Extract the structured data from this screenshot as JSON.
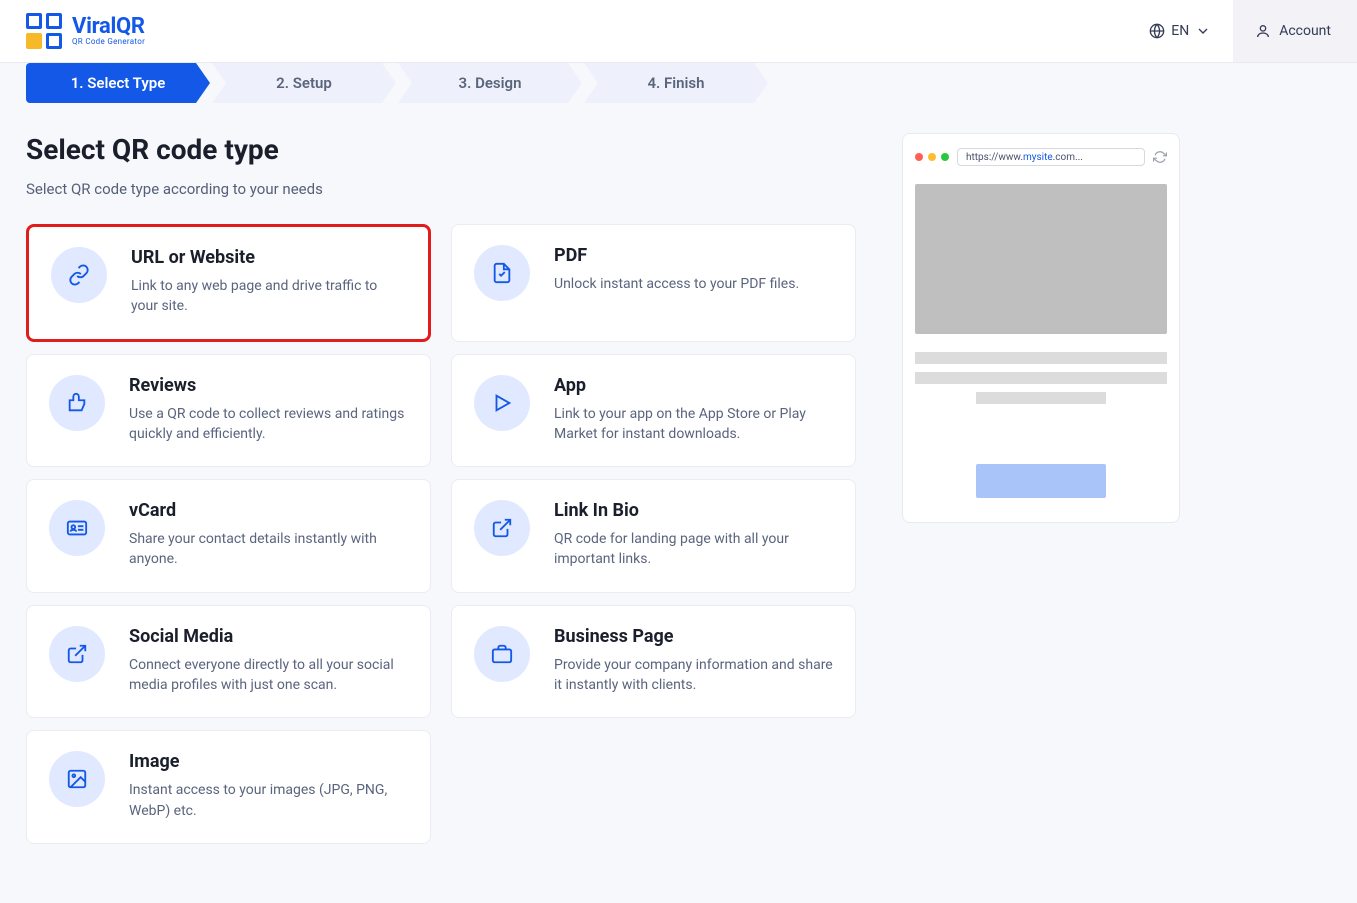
{
  "brand": {
    "name": "ViralQR",
    "tagline": "QR Code Generator"
  },
  "header": {
    "lang": "EN",
    "account": "Account"
  },
  "steps": [
    {
      "label": "1. Select Type",
      "active": true
    },
    {
      "label": "2. Setup",
      "active": false
    },
    {
      "label": "3. Design",
      "active": false
    },
    {
      "label": "4. Finish",
      "active": false
    }
  ],
  "title": "Select QR code type",
  "subtitle": "Select QR code type according to your needs",
  "cards": [
    {
      "icon": "link-icon",
      "title": "URL or Website",
      "desc": "Link to any web page and drive traffic to your site.",
      "highlight": true
    },
    {
      "icon": "pdf-icon",
      "title": "PDF",
      "desc": "Unlock instant access to your PDF files."
    },
    {
      "icon": "thumbsup-icon",
      "title": "Reviews",
      "desc": "Use a QR code to collect reviews and ratings quickly and efficiently."
    },
    {
      "icon": "play-icon",
      "title": "App",
      "desc": "Link to your app on the App Store or Play Market for instant downloads."
    },
    {
      "icon": "idcard-icon",
      "title": "vCard",
      "desc": "Share your contact details instantly with anyone."
    },
    {
      "icon": "external-icon",
      "title": "Link In Bio",
      "desc": "QR code for landing page with all your important links."
    },
    {
      "icon": "external-icon",
      "title": "Social Media",
      "desc": "Connect everyone directly to all your social media profiles with just one scan."
    },
    {
      "icon": "briefcase-icon",
      "title": "Business Page",
      "desc": "Provide your company information and share it instantly with clients."
    },
    {
      "icon": "image-icon",
      "title": "Image",
      "desc": "Instant access to your images (JPG, PNG, WebP) etc."
    }
  ],
  "preview": {
    "url_pre": "https://www.",
    "url_colored": "mysite",
    "url_post": ".com..."
  }
}
